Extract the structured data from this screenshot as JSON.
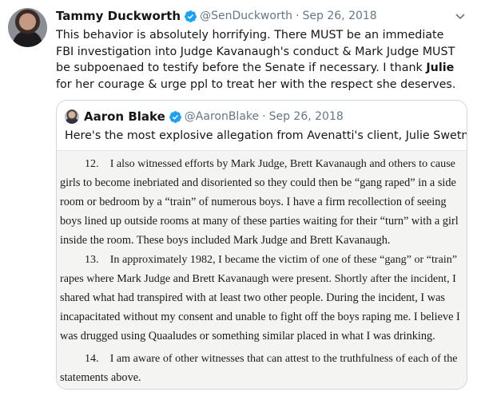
{
  "tweet": {
    "author_name": "Tammy Duckworth",
    "author_handle": "@SenDuckworth",
    "separator": "·",
    "date": "Sep 26, 2018",
    "text_before": "This behavior is absolutely horrifying. There MUST be an immediate FBI investigation into Judge Kavanaugh's conduct & Mark Judge MUST be subpoenaed to testify before the Senate if necessary. I thank ",
    "text_bold": "Julie",
    "text_after": " for her courage & urge ppl to treat her with the respect she deserves."
  },
  "quoted": {
    "author_name": "Aaron Blake",
    "author_handle": "@AaronBlake",
    "separator": "·",
    "date": "Sep 26, 2018",
    "text": "Here's the most explosive allegation from Avenatti's client, Julie Swetnick"
  },
  "document_lines": [
    "12. I also witnessed efforts by Mark Judge, Brett Kavanaugh and others to cause",
    "girls to become inebriated and disoriented so they could then be “gang raped” in a side",
    "room or bedroom by a “train” of numerous boys.  I have a firm recollection of seeing",
    "boys lined up outside rooms at many of these parties waiting for their “turn” with a girl",
    "inside the room.  These boys included Mark Judge and Brett Kavanaugh.",
    "13. In approximately 1982, I became the victim of one of these “gang” or “train”",
    "rapes where Mark Judge and Brett Kavanaugh were present. Shortly after the incident, I",
    "shared what had transpired with at least two other people.  During the incident, I was",
    "incapacitated without my consent and unable to fight off the boys raping me. I believe I",
    "was drugged using Quaaludes or something similar placed in what I was drinking.",
    "14. I am aware of other witnesses that can attest to the truthfulness of each of the",
    "statements above."
  ],
  "colors": {
    "text": "#14171a",
    "secondary": "#657786",
    "verified": "#1da1f2",
    "border": "#ccd6dd"
  },
  "icons": [
    "verified-badge-icon",
    "chevron-down-icon"
  ]
}
